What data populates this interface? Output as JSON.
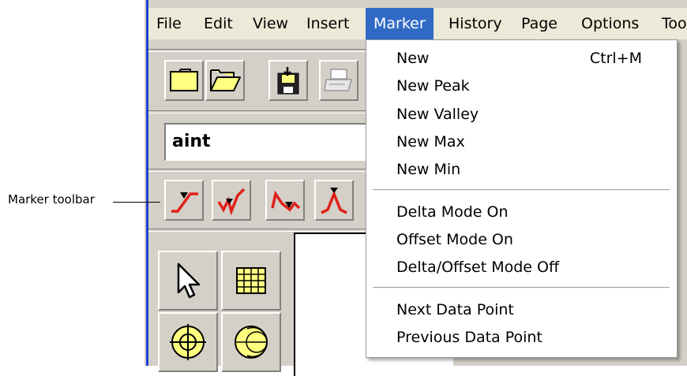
{
  "menubar": {
    "items": [
      "File",
      "Edit",
      "View",
      "Insert",
      "Marker",
      "History",
      "Page",
      "Options",
      "Too"
    ],
    "active": "Marker"
  },
  "text_box": {
    "value": "aint"
  },
  "callout": {
    "label": "Marker toolbar"
  },
  "marker_menu": {
    "items": [
      {
        "label": "New",
        "shortcut": "Ctrl+M"
      },
      {
        "label": "New Peak"
      },
      {
        "label": "New Valley"
      },
      {
        "label": "New Max"
      },
      {
        "label": "New Min"
      },
      {
        "label": "Delta Mode On"
      },
      {
        "label": "Offset Mode On"
      },
      {
        "label": "Delta/Offset Mode Off"
      },
      {
        "label": "Next Data Point"
      },
      {
        "label": "Previous Data Point"
      }
    ]
  },
  "icons": {
    "file_toolbar": [
      "new-folder-icon",
      "open-folder-icon",
      "save-disk-icon",
      "print-icon"
    ],
    "marker_toolbar": [
      "marker-new-icon",
      "marker-peak-icon",
      "marker-valley-icon",
      "marker-max-icon"
    ],
    "tools": [
      "pointer-arrow-icon",
      "grid-table-icon",
      "polar-chart-icon",
      "smith-chart-icon"
    ]
  },
  "colors": {
    "highlight": "#316ac5",
    "window_border": "#1d3fd0",
    "marker_red": "#e0201a",
    "icon_yellow": "#ffff80"
  }
}
